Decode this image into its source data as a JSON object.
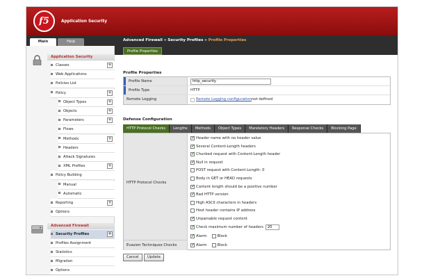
{
  "app": {
    "logo_text": "f5",
    "title": "Application Security"
  },
  "top_tabs": [
    {
      "label": "Main"
    },
    {
      "label": "Help"
    }
  ],
  "breadcrumb": {
    "part1": "Advanced Firewall",
    "sep": " » ",
    "part2": "Security Profiles",
    "part3": "Profile Properties"
  },
  "sidebar": {
    "app_security": {
      "title": "Application Security",
      "items": [
        {
          "label": "Classes",
          "expandable": true
        },
        {
          "label": "Web Applications"
        },
        {
          "label": "Policies List"
        },
        {
          "label": "Policy",
          "expandable": true
        },
        {
          "label": "Object Types",
          "expandable": true
        },
        {
          "label": "Objects",
          "expandable": true
        },
        {
          "label": "Parameters",
          "expandable": true
        },
        {
          "label": "Flows"
        },
        {
          "label": "Methods",
          "expandable": true
        },
        {
          "label": "Headers"
        },
        {
          "label": "Attack Signatures"
        },
        {
          "label": "XML Profiles",
          "expandable": true
        },
        {
          "label": "Policy Building"
        },
        {
          "label": "Manual"
        },
        {
          "label": "Automatic"
        },
        {
          "label": "Reporting",
          "expandable": true
        },
        {
          "label": "Options"
        }
      ]
    },
    "adv_firewall": {
      "title": "Advanced Firewall",
      "items": [
        {
          "label": "Security Profiles",
          "expandable": true
        },
        {
          "label": "Profiles Assignment"
        },
        {
          "label": "Statistics"
        },
        {
          "label": "Migration"
        },
        {
          "label": "Options"
        }
      ]
    }
  },
  "subtab": {
    "label": "Profile Properties"
  },
  "profile": {
    "section_title": "Profile Properties",
    "name_label": "Profile Name",
    "name_value": "http_security",
    "type_label": "Profile Type",
    "type_value": "HTTP",
    "logging_label": "Remote Logging",
    "logging_link": "Remote Logging configuration",
    "logging_suffix": " not defined"
  },
  "defense": {
    "section_title": "Defense Configuration",
    "tabs": [
      "HTTP Protocol Checks",
      "Lengths",
      "Methods",
      "Object Types",
      "Mandatory Headers",
      "Response Checks",
      "Blocking Page"
    ],
    "checks_label": "HTTP Protocol Checks",
    "checks": [
      {
        "label": "Header name with no header value",
        "checked": true
      },
      {
        "label": "Several Content-Length headers",
        "checked": true
      },
      {
        "label": "Chunked request with Content-Length header",
        "checked": true
      },
      {
        "label": "Null in request",
        "checked": true
      },
      {
        "label": "POST request with Content-Length: 0",
        "checked": false
      },
      {
        "label": "Body in GET or HEAD requests",
        "checked": false
      },
      {
        "label": "Content length should be a positive number",
        "checked": true
      },
      {
        "label": "Bad HTTP version",
        "checked": true
      },
      {
        "label": "High ASCII characters in headers",
        "checked": false
      },
      {
        "label": "Host header contains IP address",
        "checked": false
      },
      {
        "label": "Unparsable request content",
        "checked": true
      },
      {
        "label": "Check maximum number of headers",
        "checked": true
      }
    ],
    "max_headers_value": "20",
    "alarm_label": "Alarm",
    "block_label": "Block",
    "checks_alarm": true,
    "checks_block": false,
    "evasion_label": "Evasion Techniques Checks",
    "evasion_alarm": true,
    "evasion_block": false
  },
  "buttons": {
    "cancel": "Cancel",
    "update": "Update"
  },
  "colors": {
    "brand_red": "#b81e1e",
    "nav_dark": "#2e2e2e",
    "tab_green": "#4a6f24",
    "active_item": "#cfd8e6",
    "group_title": "#b8312f"
  }
}
